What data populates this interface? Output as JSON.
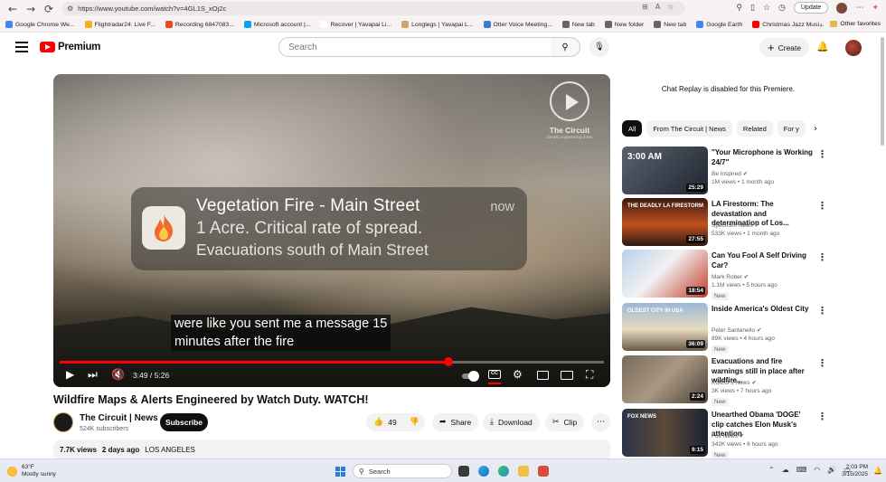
{
  "browser": {
    "url": "https://www.youtube.com/watch?v=4GL1S_xOj2c",
    "update_label": "Update",
    "bookmarks": [
      {
        "label": "Google Chrome We...",
        "color": "#4285f4"
      },
      {
        "label": "Flightradar24: Live F...",
        "color": "#f2b01e"
      },
      {
        "label": "Recording 6847083...",
        "color": "#e34c26"
      },
      {
        "label": "Microsoft account |...",
        "color": "#00a4ef"
      },
      {
        "label": "Recover | Yavapai Li...",
        "color": "#ffffff"
      },
      {
        "label": "Longlegs | Yavapai L...",
        "color": "#c9a86a"
      },
      {
        "label": "Otter Voice Meeting...",
        "color": "#3a7bd5"
      },
      {
        "label": "New tab",
        "color": "#666666"
      },
      {
        "label": "New folder",
        "color": "#666666"
      },
      {
        "label": "New tab",
        "color": "#666666"
      },
      {
        "label": "Google Earth",
        "color": "#4285f4"
      },
      {
        "label": "Christmas Jazz Musi...",
        "color": "#ff0000"
      }
    ],
    "other_favorites": "Other favorites"
  },
  "header": {
    "logo_text": "Premium",
    "search_placeholder": "Search",
    "create_label": "Create"
  },
  "player": {
    "watermark_name": "The Circuit",
    "watermark_tag": "Deeply engineering news",
    "notification": {
      "title": "Vegetation Fire - Main Street",
      "line1": "1 Acre. Critical rate of spread.",
      "line2": "Evacuations south of Main Street",
      "time": "now"
    },
    "caption_line1": "were like you sent me a message 15",
    "caption_line2": "minutes after the fire",
    "current_time": "3:49",
    "duration": "5:26",
    "time_display": "3:49 / 5:26",
    "progress": 0.714,
    "cc_label": "CC"
  },
  "video": {
    "title": "Wildfire Maps & Alerts Engineered by Watch Duty. WATCH!",
    "channel": "The Circuit | News",
    "subscribers": "524K subscribers",
    "subscribe_label": "Subscribe",
    "likes": "49",
    "share_label": "Share",
    "download_label": "Download",
    "clip_label": "Clip",
    "views": "7.7K views",
    "age": "2 days ago",
    "location": "LOS ANGELES"
  },
  "sidebar": {
    "chat_replay": "Chat Replay is disabled for this Premiere.",
    "chips": [
      "All",
      "From The Circuit | News",
      "Related",
      "For y"
    ],
    "recommendations": [
      {
        "title": "\"Your Microphone is Working 24/7\"",
        "channel": "Be Inspired",
        "stats": "1M views • 1 month ago",
        "duration": "25:29",
        "badge": "",
        "thumb_text": "3:00 AM"
      },
      {
        "title": "LA Firestorm: The devastation and determination of Los...",
        "channel": "Spectrum News",
        "stats": "533K views • 1 month ago",
        "duration": "27:55",
        "badge": "",
        "thumb_text": "THE DEADLY LA FIRESTORM"
      },
      {
        "title": "Can You Fool A Self Driving Car?",
        "channel": "Mark Rober",
        "stats": "1.1M views • 5 hours ago",
        "duration": "18:54",
        "badge": "New",
        "thumb_text": ""
      },
      {
        "title": "Inside America's Oldest City",
        "channel": "Peter Santenello",
        "stats": "89K views • 4 hours ago",
        "duration": "36:09",
        "badge": "New",
        "thumb_text": "OLDEST CITY IN USA"
      },
      {
        "title": "Evacuations and fire warnings still in place after wildfire...",
        "channel": "KOCO 5 News",
        "stats": "3K views • 7 hours ago",
        "duration": "2:24",
        "badge": "New",
        "thumb_text": ""
      },
      {
        "title": "Unearthed Obama 'DOGE' clip catches Elon Musk's attention",
        "channel": "Fox News",
        "stats": "342K views • 6 hours ago",
        "duration": "9:15",
        "badge": "New",
        "thumb_text": "FOX NEWS"
      }
    ]
  },
  "taskbar": {
    "temp": "63°F",
    "weather": "Mostly sunny",
    "search_placeholder": "Search",
    "time": "2:03 PM",
    "date": "3/15/2025"
  }
}
